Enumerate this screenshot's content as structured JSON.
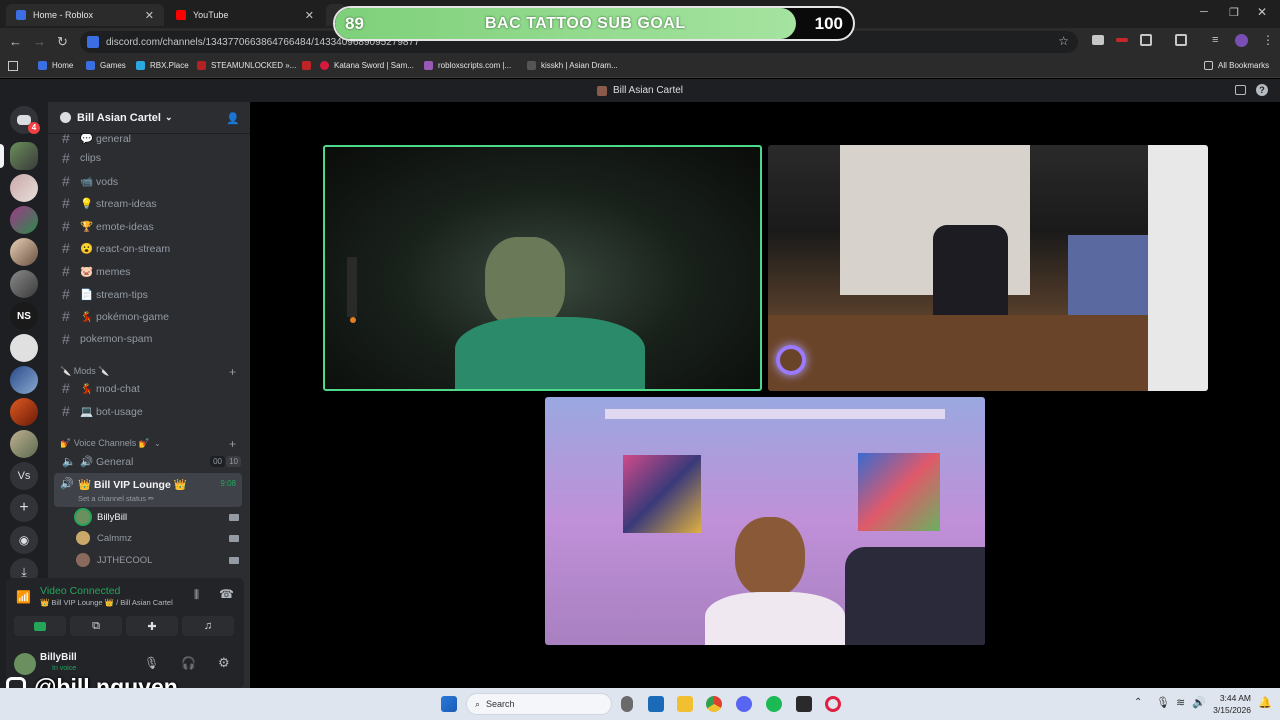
{
  "browser": {
    "tabs": [
      {
        "title": "Home - Roblox",
        "color": "#3b6de3"
      },
      {
        "title": "YouTube",
        "color": "#ff0000"
      }
    ],
    "url": "discord.com/channels/1343770663864766484/1433409689095279877",
    "bookmarks": [
      {
        "label": "Home",
        "color": "#3b6de3"
      },
      {
        "label": "Games",
        "color": "#3b6de3"
      },
      {
        "label": "RBX.Place",
        "color": "#2aa8e0"
      },
      {
        "label": "STEAMUNLOCKED »...",
        "color": "#b32222"
      },
      {
        "label": "",
        "color": "#c02525"
      },
      {
        "label": "Katana Sword | Sam...",
        "color": "#d6193c"
      },
      {
        "label": "robloxscripts.com |...",
        "color": "#9b59b6"
      },
      {
        "label": "kisskh | Asian Dram...",
        "color": "#444"
      }
    ],
    "all_bookmarks": "All Bookmarks"
  },
  "goal": {
    "start": "89",
    "label": "BAC TATTOO SUB GOAL",
    "target": "100",
    "progress": 0.89
  },
  "discord": {
    "window_title": "Bill Asian Cartel",
    "rail_badge": "4",
    "rail_labels": [
      "NS",
      "Vs"
    ],
    "server_name": "Bill Asian Cartel",
    "channels": [
      {
        "name": "💬 general"
      },
      {
        "name": "clips"
      },
      {
        "name": "📹 vods"
      },
      {
        "name": "💡 stream-ideas"
      },
      {
        "name": "🏆 emote-ideas"
      },
      {
        "name": "😮 react-on-stream"
      },
      {
        "name": "🐷 memes"
      },
      {
        "name": "📄 stream-tips"
      },
      {
        "name": "💃 pokémon-game"
      },
      {
        "name": "pokemon-spam"
      }
    ],
    "mods_category": "🔪 Mods 🔪",
    "mod_channels": [
      {
        "name": "💃 mod-chat"
      },
      {
        "name": "💻 bot-usage"
      }
    ],
    "voice_category": "💅 Voice Channels 💅",
    "voice_general": {
      "name": "🔊 General",
      "c1": "00",
      "c2": "10"
    },
    "vip_lounge": {
      "name": "👑 Bill VIP Lounge 👑",
      "time": "9:08",
      "status": "Set a channel status ✏"
    },
    "voice_users": [
      {
        "name": "BillyBill",
        "color": "#6b8f5e"
      },
      {
        "name": "Calmmz",
        "color": "#c9a86a"
      },
      {
        "name": "JJTHECOOL",
        "color": "#8a6a5c"
      }
    ],
    "connection": {
      "status": "Video Connected",
      "location": "👑 Bill VIP Lounge 👑 / Bill Asian Cartel"
    },
    "user": {
      "name": "BillyBill",
      "status": "In voice"
    }
  },
  "overlay_handle": "@bill.nguyen",
  "taskbar": {
    "search": "Search",
    "time": "3:44 AM",
    "date": "3/15/2026"
  }
}
